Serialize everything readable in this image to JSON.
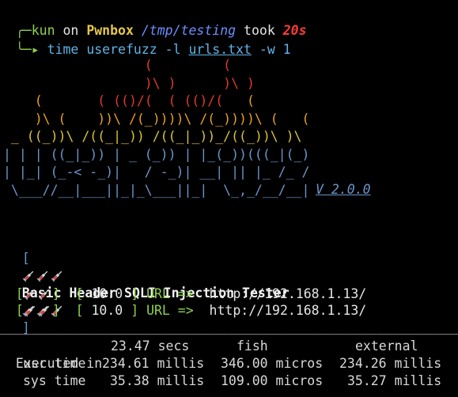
{
  "prompt": {
    "user": "kun",
    "on": "on",
    "host": "Pwnbox",
    "path": "/tmp/testing",
    "took": "took",
    "duration": "20s",
    "arrow_top": "╭─",
    "arrow_bottom": "╰─▸"
  },
  "command": {
    "bin": "time",
    "tool": "userefuzz",
    "flag_l": "-l",
    "file": "urls.txt",
    "flag_w": "-w",
    "workers": "1"
  },
  "banner": {
    "version": "V 2.0.0",
    "art_lines": [
      [
        {
          "c": "r",
          "t": "                  (         ("
        }
      ],
      [
        {
          "c": "r",
          "t": "                  )\\ )      )\\ )"
        }
      ],
      [
        {
          "c": "o",
          "t": "    (       "
        },
        {
          "c": "r",
          "t": "( (()/(  ( (()/(   "
        },
        {
          "c": "o",
          "t": "("
        }
      ],
      [
        {
          "c": "o",
          "t": "    )\\ (    ))\\ /(_))))\\ /(_))))\\ (   ("
        }
      ],
      [
        {
          "c": "y",
          "t": " _ ((_))\\ /((_|_)) /((_|_))_/((_))\\ )\\"
        }
      ],
      [
        {
          "c": "b",
          "t": "| | | ((_|_)) | _ (_)) | |_(_))(((_|(_)"
        }
      ],
      [
        {
          "c": "b",
          "t": "| |_| (_-< -_)|   / -_)| __| || |_ /_ /"
        }
      ],
      [
        {
          "c": "b",
          "t": " \\___//__|___||_|_\\___||_|  \\_,_/__/__| "
        }
      ]
    ]
  },
  "title": {
    "open": "[",
    "text": "Basic Header SQLI Injection Tester",
    "close": "]"
  },
  "results": [
    {
      "timeout": "10.0",
      "label": "URL =>",
      "url": "http://192.168.1.13/"
    },
    {
      "timeout": "10.0",
      "label": "URL =>",
      "url": "http://192.168.1.13/"
    }
  ],
  "timing": {
    "separator": "____________________________________________________________",
    "header": {
      "label": "Executed in",
      "value": "23.47 secs",
      "col2": "fish",
      "col3": "external"
    },
    "rows": [
      {
        "label": "usr time",
        "v1": "234.61 millis",
        "v2": "346.00 micros",
        "v3": "234.26 millis"
      },
      {
        "label": "sys time",
        "v1": "35.38 millis",
        "v2": "109.00 micros",
        "v3": "35.27 millis"
      }
    ]
  },
  "colors": {
    "background": "#000000",
    "user": "#8fd14f",
    "host": "#e6c84a",
    "path": "#6a8fff",
    "duration": "#ff3b3b",
    "command": "#5fb3e6",
    "flames": "#e03a2a",
    "art_blue": "#6a95c8",
    "result_bracket": "#8fd14f"
  },
  "icons": {
    "syringe": "syringe-icon"
  }
}
